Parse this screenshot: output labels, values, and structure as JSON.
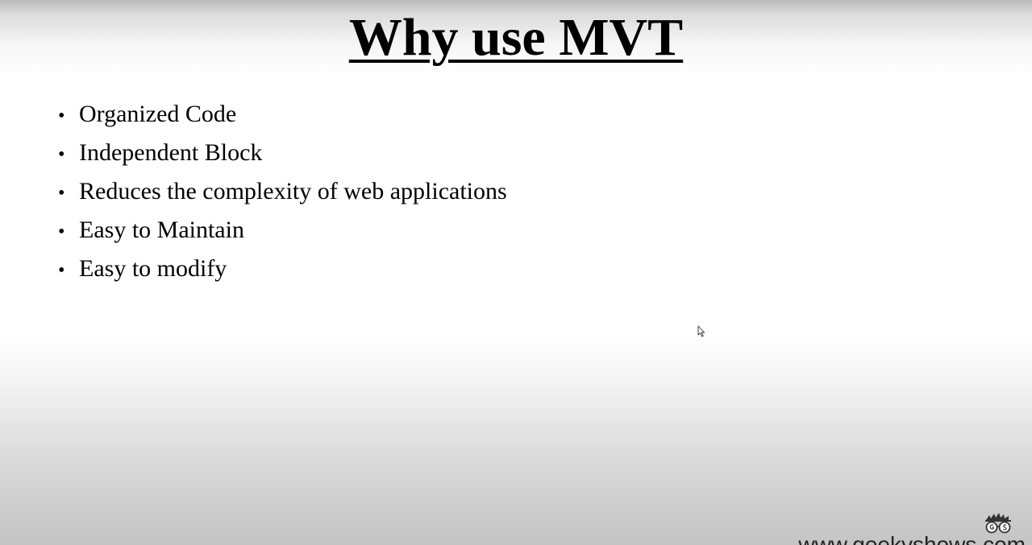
{
  "slide": {
    "title": "Why use MVT",
    "bullets": [
      "Organized Code",
      "Independent Block",
      "Reduces the complexity of web applications",
      "Easy to Maintain",
      "Easy to modify"
    ],
    "bullet_glyph": "•"
  },
  "branding": {
    "logo_icon": "geek-glasses-icon",
    "site_url": "www.geekyshows.com"
  }
}
